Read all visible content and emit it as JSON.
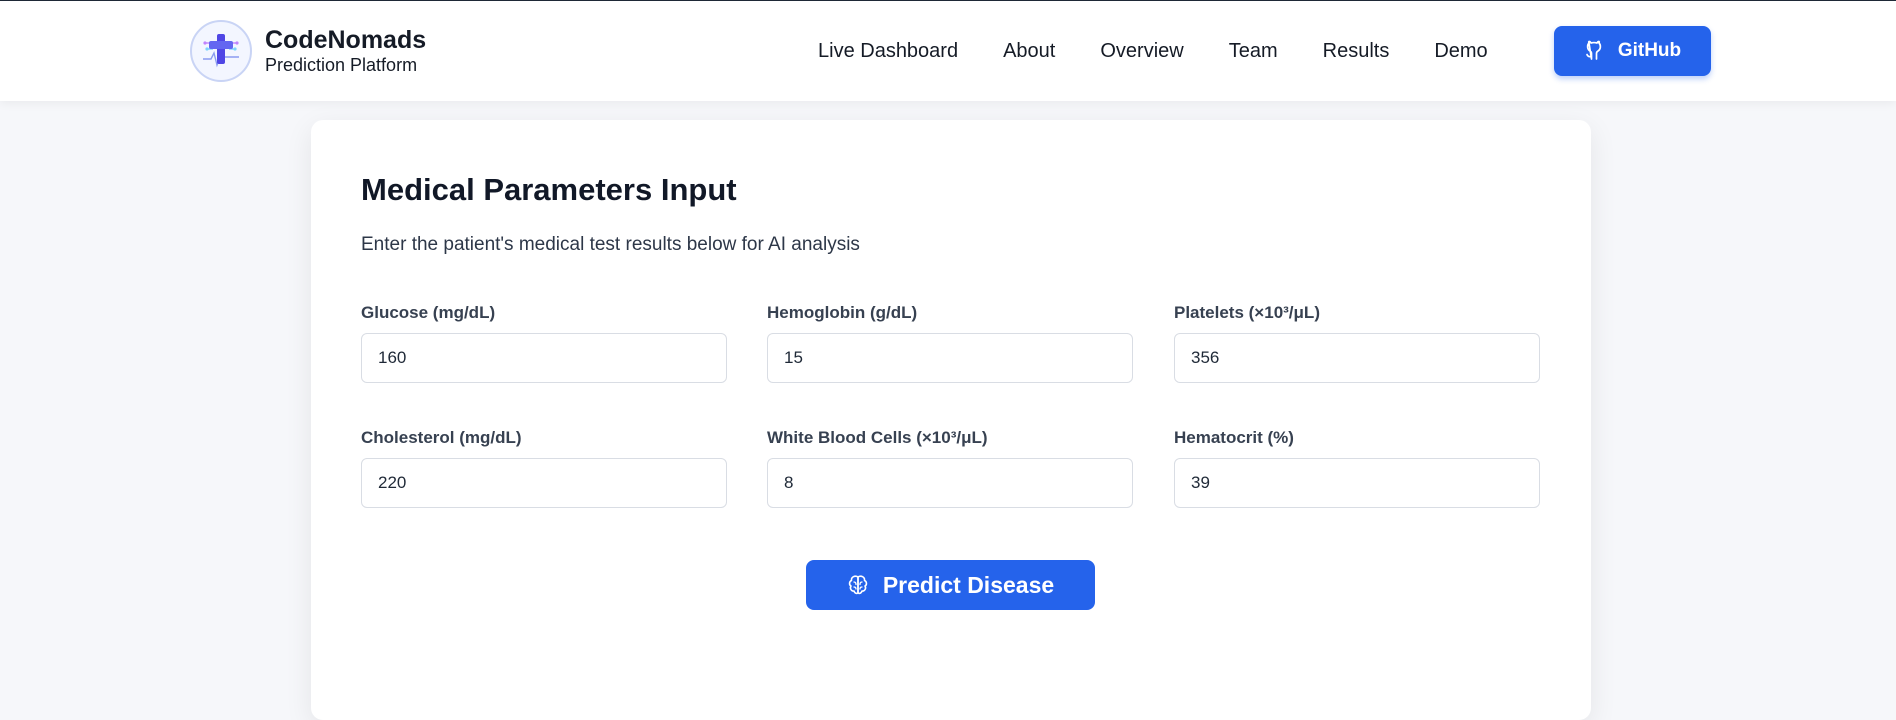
{
  "brand": {
    "name": "CodeNomads",
    "subtitle": "Prediction Platform",
    "logo_icon": "medical-cross-icon"
  },
  "nav": {
    "links": [
      "Live Dashboard",
      "About",
      "Overview",
      "Team",
      "Results",
      "Demo"
    ],
    "github_label": "GitHub",
    "github_icon": "github-icon"
  },
  "form": {
    "title": "Medical Parameters Input",
    "description": "Enter the patient's medical test results below for AI analysis",
    "fields": [
      {
        "label": "Glucose (mg/dL)",
        "value": "160"
      },
      {
        "label": "Hemoglobin (g/dL)",
        "value": "15"
      },
      {
        "label": "Platelets (×10³/μL)",
        "value": "356"
      },
      {
        "label": "Cholesterol (mg/dL)",
        "value": "220"
      },
      {
        "label": "White Blood Cells (×10³/μL)",
        "value": "8"
      },
      {
        "label": "Hematocrit (%)",
        "value": "39"
      }
    ],
    "submit_label": "Predict Disease",
    "submit_icon": "brain-icon"
  },
  "colors": {
    "accent": "#2563eb",
    "page_background": "#f6f7fa",
    "card_background": "#ffffff",
    "text_dark": "#111827"
  }
}
